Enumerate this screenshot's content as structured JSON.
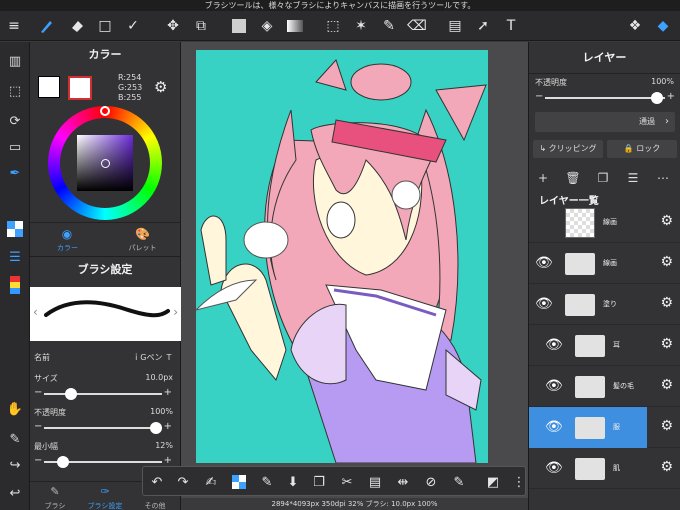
{
  "notice": "ブラシツールは、様々なブラシによりキャンバスに描画を行うツールです。",
  "toolbar": {
    "icons": [
      "menu-icon",
      "brush-icon",
      "eraser-icon",
      "square-icon",
      "checkmark-icon",
      "move-icon",
      "transform-icon",
      "fill-color-icon",
      "bucket-icon",
      "gradient-icon",
      "select-rect-icon",
      "magic-wand-icon",
      "select-pen-icon",
      "select-eraser-icon",
      "layout-icon",
      "pointer-icon",
      "text-icon",
      "materials-icon",
      "layers-icon"
    ],
    "text_tool": "T"
  },
  "color_panel": {
    "title": "カラー",
    "r": "R:254",
    "g": "G:253",
    "b": "B:255",
    "tab_color": "カラー",
    "tab_palette": "パレット",
    "selected_hue_color": "#6a2bd8"
  },
  "brush_panel": {
    "title": "ブラシ設定",
    "name_label": "名前",
    "name_value": "ｉGペン Ｔ",
    "size_label": "サイズ",
    "size_value": "10.0px",
    "size_level": 0.2,
    "opacity_label": "不透明度",
    "opacity_value": "100%",
    "opacity_level": 1.0,
    "min_width_label": "最小幅",
    "min_width_value": "12%",
    "min_width_level": 0.12,
    "tab_brush": "ブラシ",
    "tab_brush_settings": "ブラシ設定",
    "tab_other": "その他"
  },
  "canvas": {
    "background_color": "#38d2c4",
    "status": "2894*4093px 350dpi 32% ブラシ: 10.0px 100%"
  },
  "layer_panel": {
    "title": "レイヤー",
    "opacity_label": "不透明度",
    "opacity_value": "100%",
    "blend_mode": "通過",
    "clipping": "クリッピング",
    "lock": "ロック",
    "list_title": "レイヤー一覧",
    "layers": [
      {
        "name": "線画",
        "type": "layer",
        "visible": false
      },
      {
        "name": "線画",
        "type": "folder",
        "visible": true
      },
      {
        "name": "塗り",
        "type": "folder",
        "visible": true
      },
      {
        "name": "耳",
        "type": "folder",
        "visible": true
      },
      {
        "name": "髪の毛",
        "type": "folder",
        "visible": true
      },
      {
        "name": "服",
        "type": "folder",
        "visible": true,
        "selected": true
      },
      {
        "name": "肌",
        "type": "folder",
        "visible": true
      }
    ]
  }
}
